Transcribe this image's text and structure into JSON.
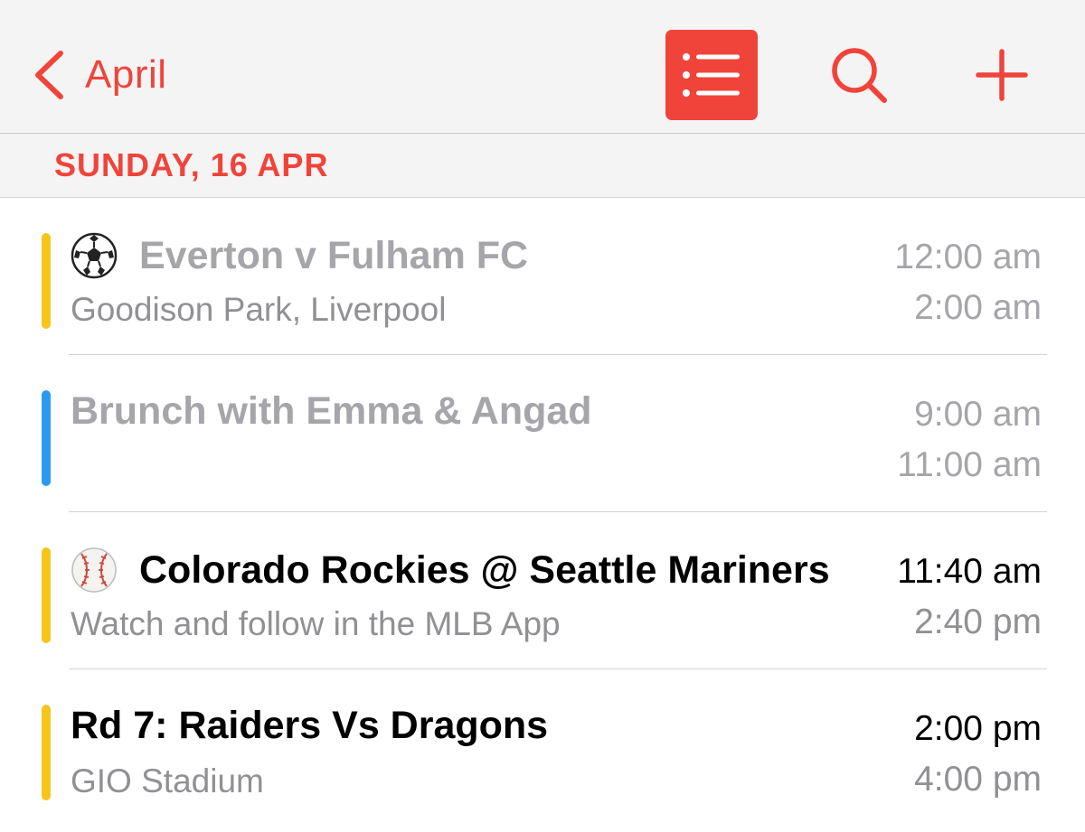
{
  "navbar": {
    "back_label": "April",
    "list_icon": "list-icon",
    "search_icon": "search-icon",
    "add_icon": "plus-icon"
  },
  "colors": {
    "accent": "#f0443a",
    "yellow": "#f6c51b",
    "blue": "#2a9bf0"
  },
  "day": {
    "label": "SUNDAY, 16 APR"
  },
  "events": [
    {
      "emoji": "soccer-ball-icon",
      "title": "Everton v Fulham FC",
      "location": "Goodison Park, Liverpool",
      "start": "12:00 am",
      "end": "2:00 am",
      "calendar_color": "#f6c51b",
      "status": "past"
    },
    {
      "title": "Brunch with Emma & Angad",
      "location": "",
      "start": "9:00 am",
      "end": "11:00 am",
      "calendar_color": "#2a9bf0",
      "status": "past"
    },
    {
      "emoji": "baseball-icon",
      "title": "Colorado Rockies @ Seattle Mariners",
      "location": "Watch and follow in the MLB App",
      "start": "11:40 am",
      "end": "2:40 pm",
      "calendar_color": "#f6c51b",
      "status": "upcoming"
    },
    {
      "title": "Rd 7: Raiders Vs Dragons",
      "location": "GIO Stadium",
      "start": "2:00 pm",
      "end": "4:00 pm",
      "calendar_color": "#f6c51b",
      "status": "upcoming"
    }
  ]
}
